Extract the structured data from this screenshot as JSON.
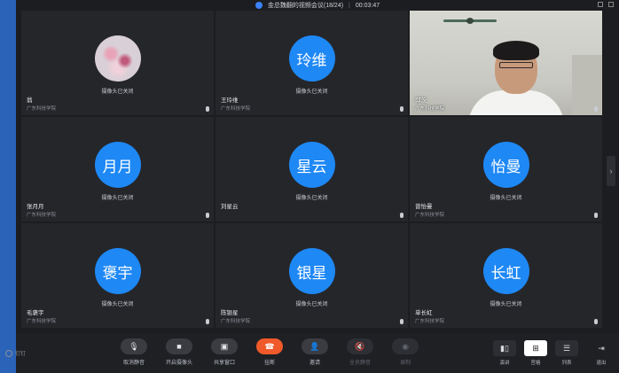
{
  "titlebar": {
    "title": "金总魏翻的视频会议(18/24)",
    "timer": "00:03:47"
  },
  "participants": [
    {
      "name": "翁",
      "org": "广东科技学院",
      "status": "摄像头已关闭",
      "avatar_text": "",
      "avatar_kind": "photo"
    },
    {
      "name": "王玲维",
      "org": "广东科技学院",
      "status": "摄像头已关闭",
      "avatar_text": "玲维",
      "avatar_kind": "initials"
    },
    {
      "name": "邱茨",
      "org": "广东科技学院",
      "status": "",
      "avatar_text": "",
      "avatar_kind": "video"
    },
    {
      "name": "张月月",
      "org": "广东科技学院",
      "status": "摄像头已关闭",
      "avatar_text": "月月",
      "avatar_kind": "initials"
    },
    {
      "name": "刘星云",
      "org": "",
      "status": "摄像头已关闭",
      "avatar_text": "星云",
      "avatar_kind": "initials"
    },
    {
      "name": "曾怡曼",
      "org": "广东科技学院",
      "status": "摄像头已关闭",
      "avatar_text": "怡曼",
      "avatar_kind": "initials"
    },
    {
      "name": "毛褒宇",
      "org": "广东科技学院",
      "status": "摄像头已关闭",
      "avatar_text": "褒宇",
      "avatar_kind": "initials"
    },
    {
      "name": "陈银星",
      "org": "广东科技学院",
      "status": "摄像头已关闭",
      "avatar_text": "银星",
      "avatar_kind": "initials"
    },
    {
      "name": "单长虹",
      "org": "广东科技学院",
      "status": "摄像头已关闭",
      "avatar_text": "长虹",
      "avatar_kind": "initials"
    }
  ],
  "toolbar": {
    "logo_label": "钉钉",
    "unmute": "取消静音",
    "camera": "开启摄像头",
    "share": "共享窗口",
    "hangup": "挂断",
    "invite": "邀请",
    "mute_all": "全员静音",
    "record": "录制"
  },
  "views": {
    "speaker": "演讲",
    "gallery": "宫格",
    "list": "列表",
    "exit": "退出"
  },
  "colors": {
    "avatar_blue": "#1e88f5",
    "hangup_orange": "#f05a2a",
    "tile_bg": "#25262a"
  }
}
